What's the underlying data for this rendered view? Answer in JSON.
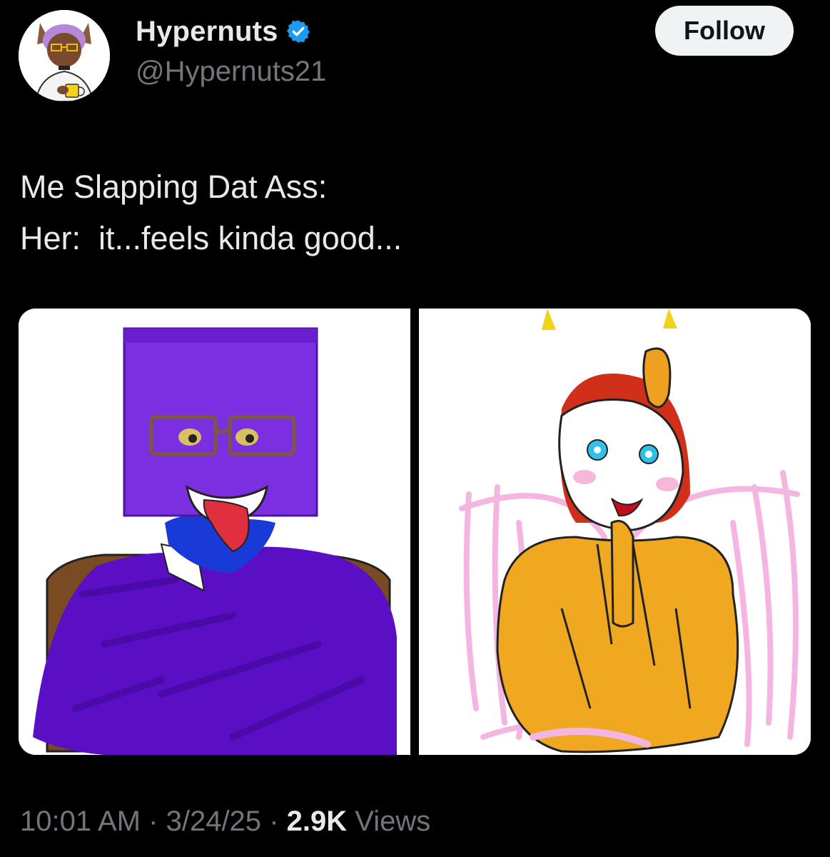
{
  "author": {
    "display_name": "Hypernuts",
    "handle": "@Hypernuts21",
    "verified": true,
    "avatar_icon": "avatar-image"
  },
  "follow_button": {
    "label": "Follow"
  },
  "tweet": {
    "lines": [
      "Me Slapping Dat Ass:",
      "Her:  it...feels kinda good..."
    ]
  },
  "media": {
    "images": [
      {
        "name": "media-image-left",
        "description_icon": "purple-scribbled-man-image"
      },
      {
        "name": "media-image-right",
        "description_icon": "orange-scribbled-character-image"
      }
    ]
  },
  "meta": {
    "time": "10:01 AM",
    "separator": "·",
    "date": "3/24/25",
    "views_count": "2.9K",
    "views_label": "Views"
  },
  "colors": {
    "background": "#000000",
    "text_primary": "#e7e9ea",
    "text_secondary": "#71767b",
    "verified": "#1d9bf0",
    "follow_bg": "#eff3f4"
  }
}
